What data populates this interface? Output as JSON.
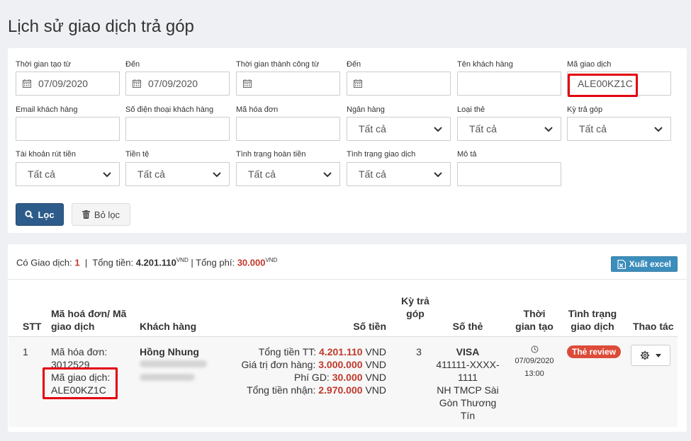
{
  "page_title": "Lịch sử giao dịch trả góp",
  "filters": {
    "created_from": {
      "label": "Thời gian tạo từ",
      "value": "07/09/2020"
    },
    "created_to": {
      "label": "Đến",
      "value": "07/09/2020"
    },
    "success_from": {
      "label": "Thời gian thành công từ",
      "value": ""
    },
    "success_to": {
      "label": "Đến",
      "value": ""
    },
    "customer_name": {
      "label": "Tên khách hàng",
      "value": ""
    },
    "transaction_code": {
      "label": "Mã giao dịch",
      "value": "ALE00KZ1C"
    },
    "customer_email": {
      "label": "Email khách hàng",
      "value": ""
    },
    "customer_phone": {
      "label": "Số điện thoại khách hàng",
      "value": ""
    },
    "invoice_code": {
      "label": "Mã hóa đơn",
      "value": ""
    },
    "bank": {
      "label": "Ngân hàng",
      "value": "Tất cả"
    },
    "card_type": {
      "label": "Loại thẻ",
      "value": "Tất cả"
    },
    "installment_term": {
      "label": "Kỳ trả góp",
      "value": "Tất cả"
    },
    "withdraw_account": {
      "label": "Tài khoản rút tiền",
      "value": "Tất cả"
    },
    "currency": {
      "label": "Tiền tệ",
      "value": "Tất cả"
    },
    "refund_status": {
      "label": "Tình trạng hoàn tiền",
      "value": "Tất cả"
    },
    "transaction_status": {
      "label": "Tình trạng giao dịch",
      "value": "Tất cả"
    },
    "description": {
      "label": "Mô tả",
      "value": ""
    }
  },
  "buttons": {
    "filter": "Lọc",
    "clear": "Bỏ lọc",
    "export": "Xuất excel"
  },
  "summary": {
    "count_label": "Có Giao dịch:",
    "count": "1",
    "sep1": "|",
    "total_label": "Tổng tiền:",
    "total": "4.201.110",
    "unit": "VND",
    "sep2": "|",
    "fee_label": "Tổng phí:",
    "fee": "30.000"
  },
  "table": {
    "headers": {
      "stt": "STT",
      "invoice": "Mã hoá đơn/ Mã giao dịch",
      "customer": "Khách hàng",
      "amount": "Số tiền",
      "term": "Kỳ trả góp",
      "card": "Số thẻ",
      "created": "Thời gian tạo",
      "status": "Tình trạng giao dịch",
      "actions": "Thao tác"
    },
    "rows": [
      {
        "stt": "1",
        "invoice_label": "Mã hóa đơn:",
        "invoice_value": "3012529",
        "txn_label": "Mã giao dịch:",
        "txn_value": "ALE00KZ1C",
        "customer_name": "Hồng Nhung",
        "amount_total_label": "Tổng tiền TT:",
        "amount_total": "4.201.110",
        "amount_order_label": "Giá trị đơn hàng:",
        "amount_order": "3.000.000",
        "amount_fee_label": "Phí GD:",
        "amount_fee": "30.000",
        "amount_received_label": "Tổng tiền nhận:",
        "amount_received": "2.970.000",
        "unit": "VND",
        "term": "3",
        "card_brand": "VISA",
        "card_number": "411111-XXXX-1111",
        "bank_name": "NH TMCP Sài Gòn Thương Tín",
        "created_date": "07/09/2020",
        "created_time": "13:00",
        "status": "Thẻ review"
      }
    ]
  },
  "colors": {
    "primary": "#2d5c8a",
    "highlight": "#e3000f",
    "amount": "#c0392b",
    "badge": "#dd4b39",
    "excel": "#3c8dbc"
  },
  "icons": {
    "date": "calendar-icon",
    "select": "chevron-down-icon",
    "filter": "search-icon",
    "clear": "trash-icon",
    "export": "excel-icon",
    "time": "clock-icon",
    "actions": "gear-icon"
  }
}
